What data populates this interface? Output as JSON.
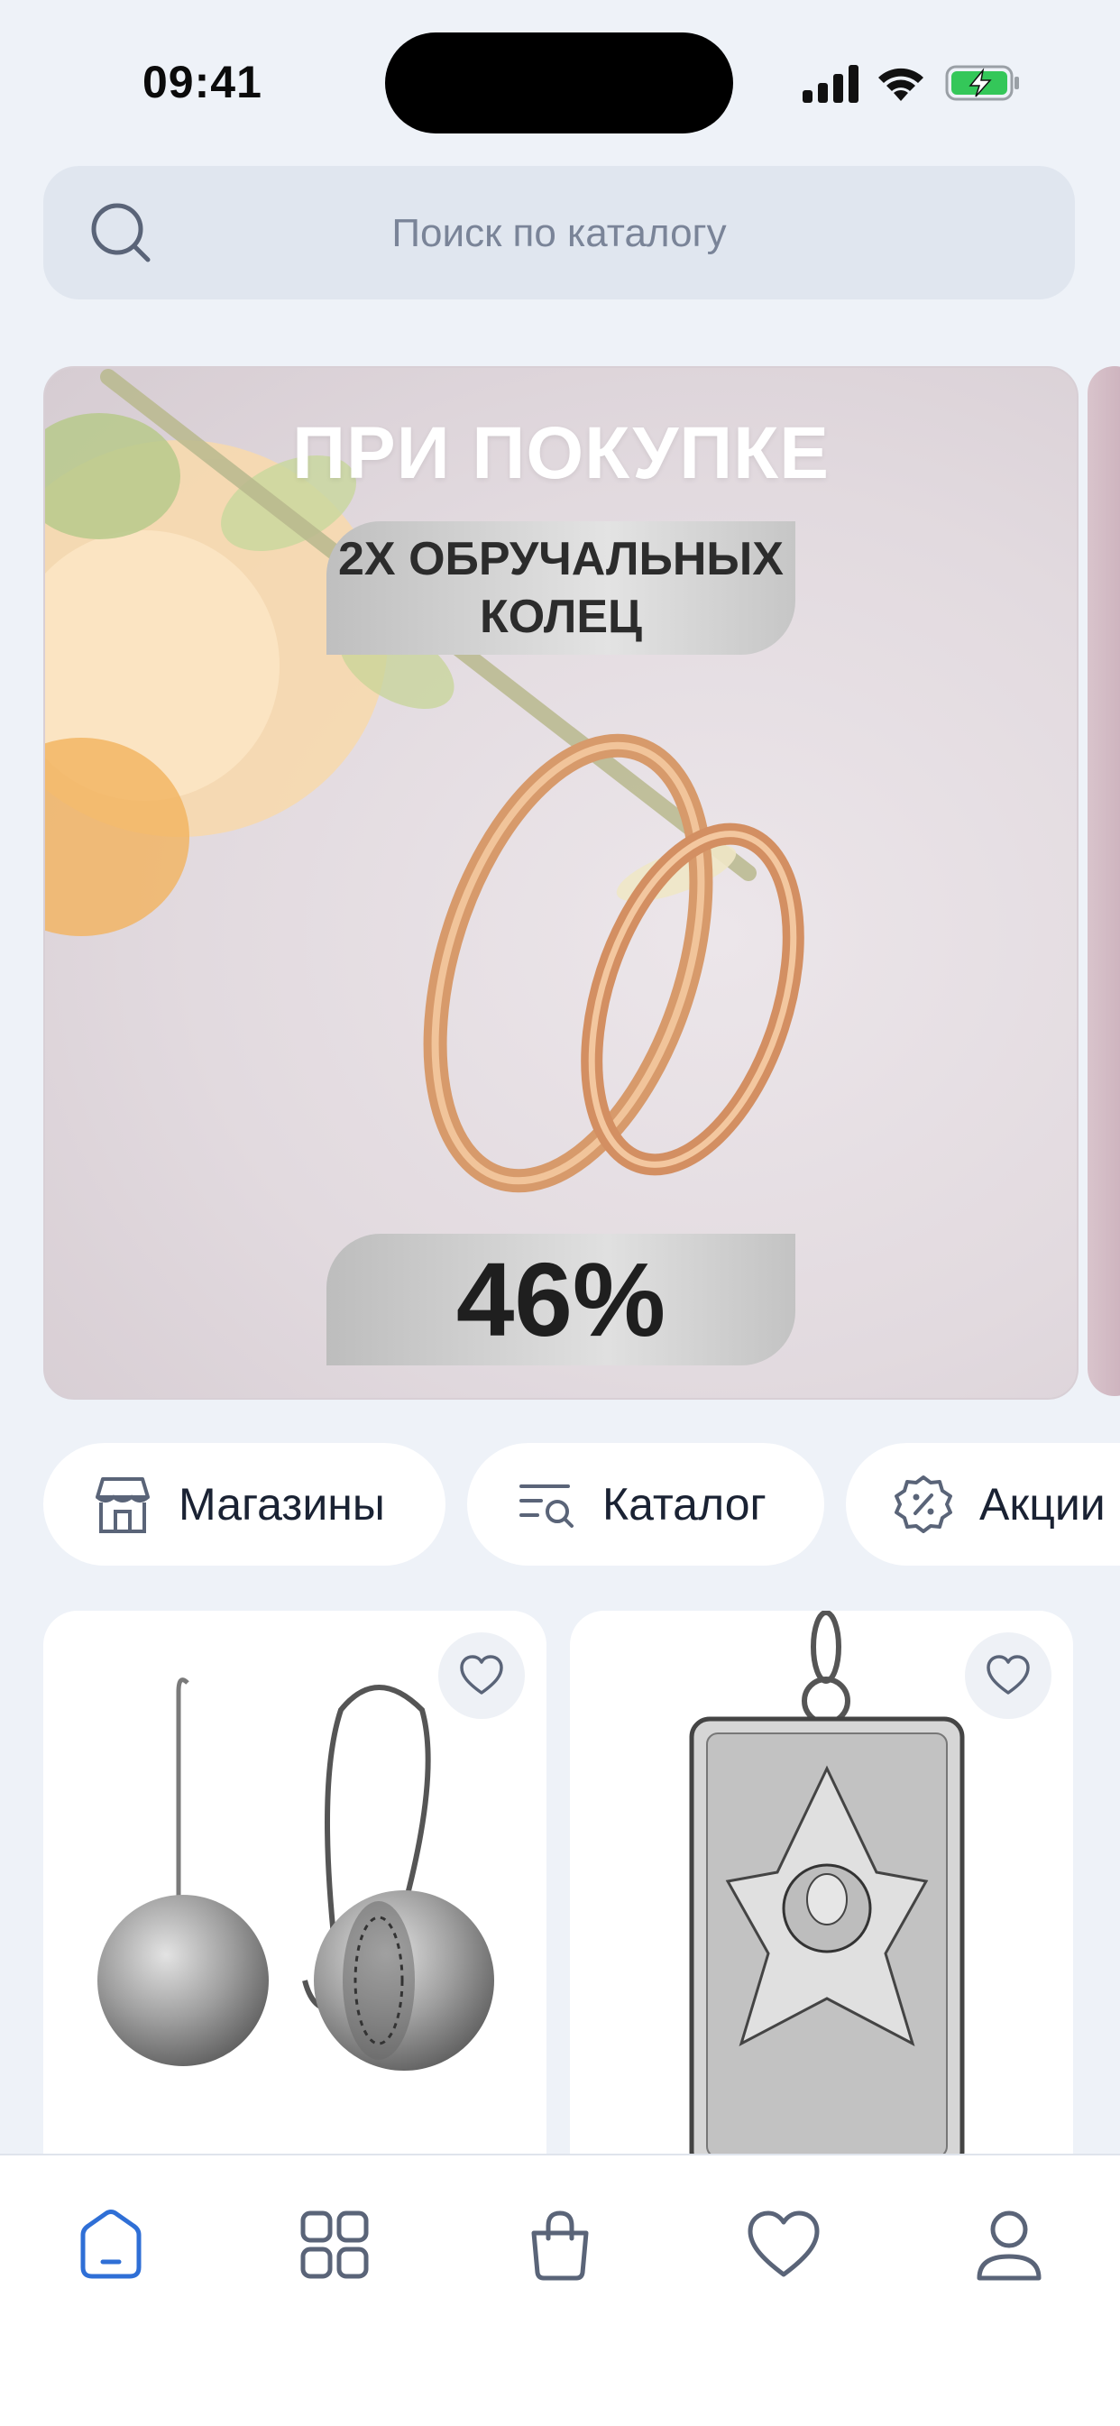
{
  "status_bar": {
    "time": "09:41",
    "icons": [
      "cellular-signal-icon",
      "wifi-icon",
      "battery-charging-icon"
    ]
  },
  "search": {
    "placeholder": "Поиск по каталогу",
    "icon": "search-icon"
  },
  "banner": {
    "title": "ПРИ ПОКУПКЕ",
    "subtitle_line1": "2Х ОБРУЧАЛЬНЫХ",
    "subtitle_line2": "КОЛЕЦ",
    "discount": "46%",
    "image": "wedding-rings-photo"
  },
  "quick_links": [
    {
      "label": "Магазины",
      "icon": "store-icon"
    },
    {
      "label": "Каталог",
      "icon": "catalog-search-icon"
    },
    {
      "label": "Акции",
      "icon": "discount-badge-icon"
    }
  ],
  "products": [
    {
      "image": "silver-ball-earrings",
      "favorite": false
    },
    {
      "image": "silver-icon-pendant",
      "favorite": false
    }
  ],
  "bottom_nav": {
    "items": [
      {
        "name": "home",
        "icon": "home-icon",
        "active": true
      },
      {
        "name": "catalog",
        "icon": "grid-icon",
        "active": false
      },
      {
        "name": "cart",
        "icon": "shopping-bag-icon",
        "active": false
      },
      {
        "name": "favorites",
        "icon": "heart-icon",
        "active": false
      },
      {
        "name": "profile",
        "icon": "user-icon",
        "active": false
      }
    ]
  },
  "colors": {
    "background": "#eef2f8",
    "accent": "#2f6fd6",
    "icon": "#5a6478",
    "search_bg": "#e0e6ef"
  }
}
